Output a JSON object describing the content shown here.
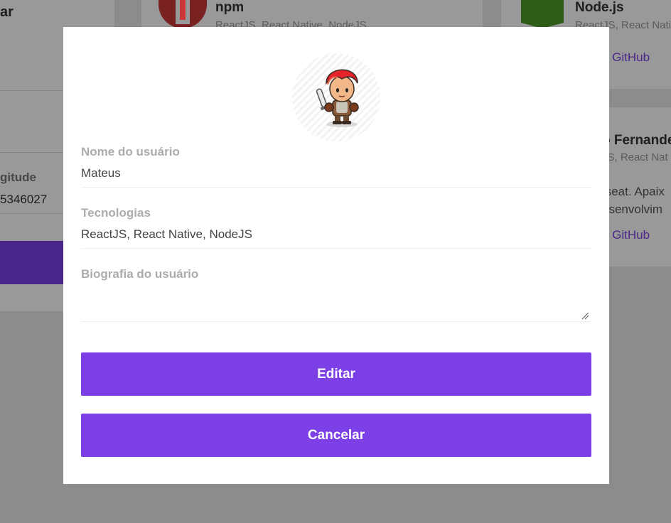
{
  "background": {
    "left_card": {
      "title_fragment": "ar",
      "label_fragment": "gitude",
      "value_fragment": "5346027"
    },
    "mid_card": {
      "name": "npm",
      "techs": "ReactJS, React Native, NodeJS"
    },
    "right_card_1": {
      "name": "Node.js",
      "techs": "ReactJS, React Native",
      "link": "o GitHub"
    },
    "right_card_2": {
      "name": "o Fernande",
      "techs": "JS, React Nat",
      "bio_line1": "tseat. Apaix",
      "bio_line2": "esenvolvim",
      "link": "o GitHub"
    }
  },
  "modal": {
    "avatar_alt": "avatar-warrior",
    "fields": {
      "username_label": "Nome do usuário",
      "username_value": "Mateus",
      "techs_label": "Tecnologias",
      "techs_value": "ReactJS, React Native, NodeJS",
      "bio_label": "Biografia do usuário",
      "bio_value": ""
    },
    "buttons": {
      "edit": "Editar",
      "cancel": "Cancelar"
    }
  },
  "colors": {
    "accent": "#7d40e7",
    "overlay": "rgba(0,0,0,0.4)"
  }
}
